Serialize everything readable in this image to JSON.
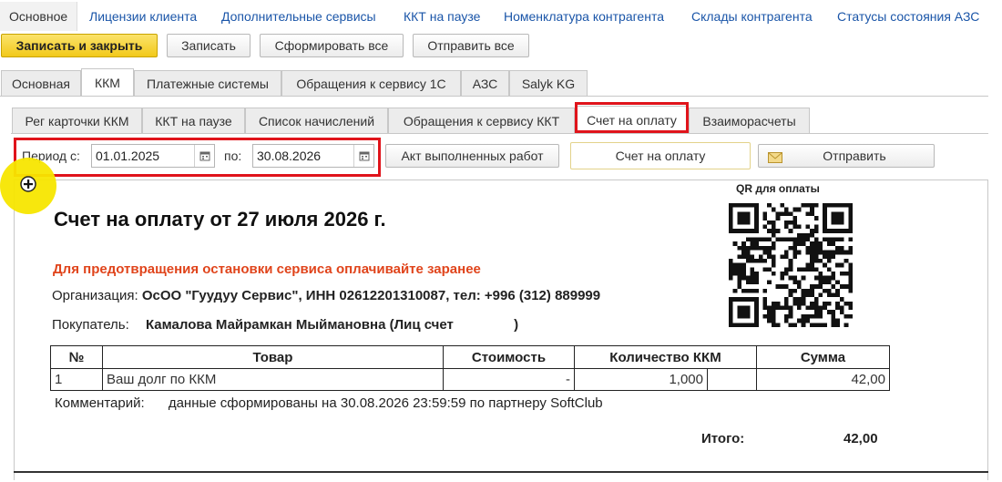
{
  "topnav": {
    "items": [
      {
        "label": "Основное"
      },
      {
        "label": "Лицензии клиента"
      },
      {
        "label": "Дополнительные сервисы"
      },
      {
        "label": "ККТ на паузе"
      },
      {
        "label": "Номенклатура контрагента"
      },
      {
        "label": "Склады контрагента"
      },
      {
        "label": "Статусы состояния АЗС"
      }
    ]
  },
  "toolbar": {
    "save_close": "Записать и закрыть",
    "save": "Записать",
    "generate_all": "Сформировать все",
    "send_all": "Отправить все"
  },
  "tabs1": [
    {
      "label": "Основная"
    },
    {
      "label": "ККМ"
    },
    {
      "label": "Платежные системы"
    },
    {
      "label": "Обращения к сервису 1С"
    },
    {
      "label": "АЗС"
    },
    {
      "label": "Salyk KG"
    }
  ],
  "tabs2": [
    {
      "label": "Рег карточки ККМ"
    },
    {
      "label": "ККТ на паузе"
    },
    {
      "label": "Список начислений"
    },
    {
      "label": "Обращения к сервису ККТ"
    },
    {
      "label": "Счет на оплату"
    },
    {
      "label": "Взаиморасчеты"
    }
  ],
  "period": {
    "from_label": "Период с:",
    "from_value": "01.01.2025",
    "to_label": "по:",
    "to_value": "30.08.2026"
  },
  "actions": {
    "act_button": "Акт выполненных работ",
    "invoice_button": "Счет на оплату",
    "send_button": "Отправить"
  },
  "document": {
    "title": "Счет на оплату от 27 июля 2026 г.",
    "warning": "Для предотвращения остановки сервиса оплачивайте заранее",
    "org_label": "Организация:",
    "org_value": "ОсОО \"Гуудуу Сервис\", ИНН 02612201310087, тел: +996 (312) 889999",
    "buyer_label": "Покупатель:",
    "buyer_value": "Камалова Майрамкан Мыймановна (Лиц счет",
    "buyer_tail": ")",
    "qr_label": "QR для оплаты",
    "table": {
      "headers": [
        "№",
        "Товар",
        "Стоимость",
        "Количество ККМ",
        "Сумма"
      ],
      "rows": [
        {
          "num": "1",
          "item": "Ваш долг по ККМ",
          "cost": "-",
          "qty": "1,000",
          "sum": "42,00"
        }
      ]
    },
    "comment_label": "Комментарий:",
    "comment_value": "данные сформированы на 30.08.2026 23:59:59 по партнеру SoftClub",
    "total_label": "Итого:",
    "total_value": "42,00"
  },
  "colors": {
    "highlight_red": "#e0141b",
    "link_blue": "#1a55a8",
    "warning_orange": "#e0441b",
    "primary_yellow": "#f2c91a"
  }
}
